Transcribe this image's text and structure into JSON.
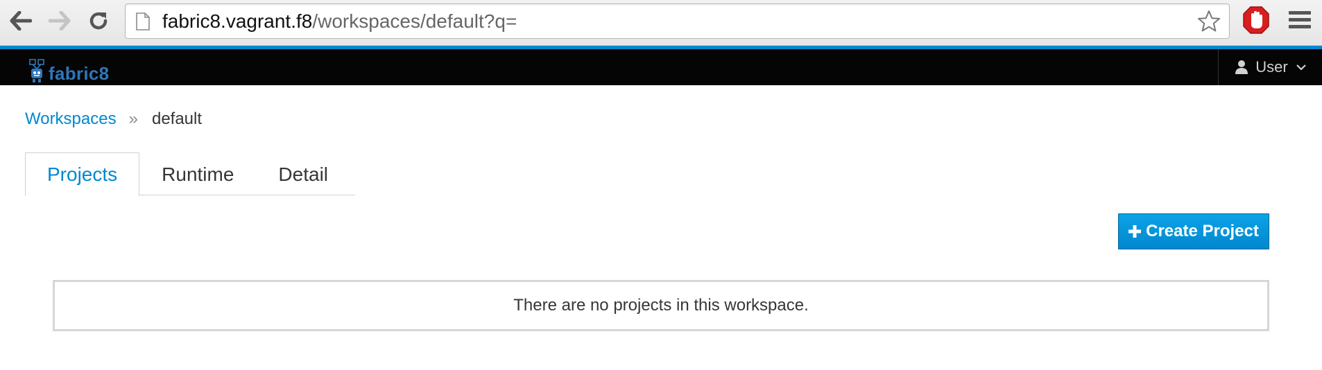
{
  "browser": {
    "url_host": "fabric8.vagrant.f8",
    "url_path": "/workspaces/default?q="
  },
  "header": {
    "logo_text": "fabric8",
    "user_label": "User"
  },
  "breadcrumb": {
    "link": "Workspaces",
    "separator": "»",
    "current": "default"
  },
  "tabs": [
    {
      "label": "Projects",
      "active": true
    },
    {
      "label": "Runtime",
      "active": false
    },
    {
      "label": "Detail",
      "active": false
    }
  ],
  "actions": {
    "create_label": "Create Project"
  },
  "empty_state": {
    "message": "There are no projects in this workspace."
  },
  "colors": {
    "accent": "#0088ce",
    "header_bg": "#050505"
  }
}
